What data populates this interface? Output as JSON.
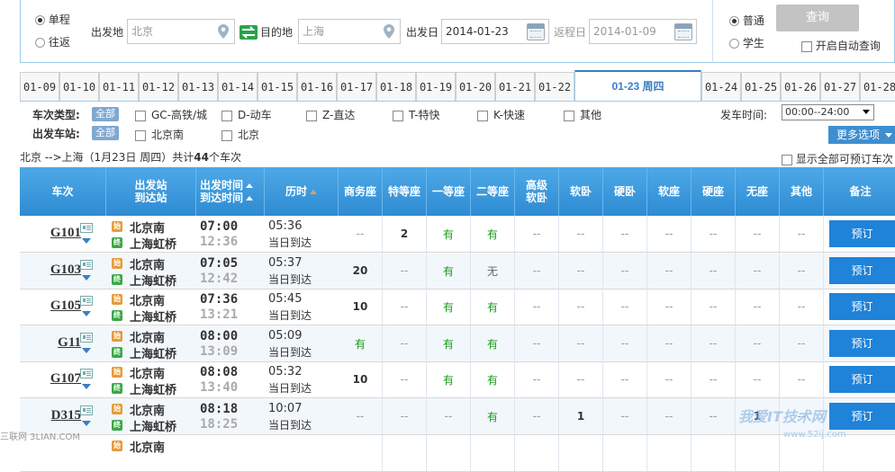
{
  "search": {
    "trip_types": [
      "单程",
      "往返"
    ],
    "from_label": "出发地",
    "from_value": "北京",
    "to_label": "目的地",
    "to_value": "上海",
    "depart_label": "出发日",
    "depart_value": "2014-01-23",
    "return_label": "返程日",
    "return_value": "2014-01-09",
    "ticket_types": [
      "普通",
      "学生"
    ],
    "query_button": "查询",
    "auto_query": "开启自动查询"
  },
  "tabs": [
    "01-09",
    "01-10",
    "01-11",
    "01-12",
    "01-13",
    "01-14",
    "01-15",
    "01-16",
    "01-17",
    "01-18",
    "01-19",
    "01-20",
    "01-21",
    "01-22",
    "01-23 周四",
    "01-24",
    "01-25",
    "01-26",
    "01-27",
    "01-28"
  ],
  "filters": {
    "train_type_label": "车次类型:",
    "all_label": "全部",
    "train_types": [
      "GC-高铁/城",
      "D-动车",
      "Z-直达",
      "T-特快",
      "K-快速",
      "其他"
    ],
    "station_label": "出发车站:",
    "stations": [
      "北京南",
      "北京"
    ],
    "depart_time_label": "发车时间:",
    "depart_time_value": "00:00--24:00",
    "more_options": "更多选项"
  },
  "summary": {
    "route": "北京 -->上海（1月23日 周四）共计",
    "count": "44",
    "suffix": "个车次",
    "show_all": "显示全部可预订车次"
  },
  "headers": {
    "train_no": "车次",
    "stations_1": "出发站",
    "stations_2": "到达站",
    "times_1": "出发时间",
    "times_2": "到达时间",
    "duration": "历时",
    "seats": [
      "商务座",
      "特等座",
      "一等座",
      "二等座",
      "高级 软卧",
      "软卧",
      "硬卧",
      "软座",
      "硬座",
      "无座",
      "其他"
    ],
    "remark": "备注"
  },
  "trains": [
    {
      "no": "G101",
      "from": "北京南",
      "to": "上海虹桥",
      "dep": "07:00",
      "arr": "12:36",
      "dur": "05:36",
      "day": "当日到达",
      "seats": [
        "--",
        "2",
        "有",
        "有",
        "--",
        "--",
        "--",
        "--",
        "--",
        "--",
        "--"
      ],
      "book": "预订"
    },
    {
      "no": "G103",
      "from": "北京南",
      "to": "上海虹桥",
      "dep": "07:05",
      "arr": "12:42",
      "dur": "05:37",
      "day": "当日到达",
      "seats": [
        "20",
        "--",
        "有",
        "无",
        "--",
        "--",
        "--",
        "--",
        "--",
        "--",
        "--"
      ],
      "book": "预订"
    },
    {
      "no": "G105",
      "from": "北京南",
      "to": "上海虹桥",
      "dep": "07:36",
      "arr": "13:21",
      "dur": "05:45",
      "day": "当日到达",
      "seats": [
        "10",
        "--",
        "有",
        "有",
        "--",
        "--",
        "--",
        "--",
        "--",
        "--",
        "--"
      ],
      "book": "预订"
    },
    {
      "no": "G11",
      "from": "北京南",
      "to": "上海虹桥",
      "dep": "08:00",
      "arr": "13:09",
      "dur": "05:09",
      "day": "当日到达",
      "seats": [
        "有",
        "--",
        "有",
        "有",
        "--",
        "--",
        "--",
        "--",
        "--",
        "--",
        "--"
      ],
      "book": "预订"
    },
    {
      "no": "G107",
      "from": "北京南",
      "to": "上海虹桥",
      "dep": "08:08",
      "arr": "13:40",
      "dur": "05:32",
      "day": "当日到达",
      "seats": [
        "10",
        "--",
        "有",
        "有",
        "--",
        "--",
        "--",
        "--",
        "--",
        "--",
        "--"
      ],
      "book": "预订"
    },
    {
      "no": "D315",
      "from": "北京南",
      "to": "上海虹桥",
      "dep": "08:18",
      "arr": "18:25",
      "dur": "10:07",
      "day": "当日到达",
      "seats": [
        "--",
        "--",
        "--",
        "有",
        "--",
        "1",
        "--",
        "--",
        "--",
        "1",
        "--"
      ],
      "book": "预订"
    },
    {
      "no": "",
      "from": "北京南",
      "to": "",
      "dep": "",
      "arr": "",
      "dur": "",
      "day": "",
      "seats": [
        "",
        "",
        "",
        "",
        "",
        "",
        "",
        "",
        "",
        "",
        ""
      ],
      "book": ""
    }
  ],
  "station_badges": {
    "start": "始",
    "end": "终"
  },
  "watermarks": {
    "left": "三联网 3LIAN.COM",
    "brand": "我爱IT技术网",
    "url": "www.52ij.com"
  },
  "colors": {
    "header_blue": "#2f8bd3",
    "book_blue": "#1f83d9",
    "available_green": "#1a9b1a",
    "active_tab": "#3a7ec2"
  }
}
